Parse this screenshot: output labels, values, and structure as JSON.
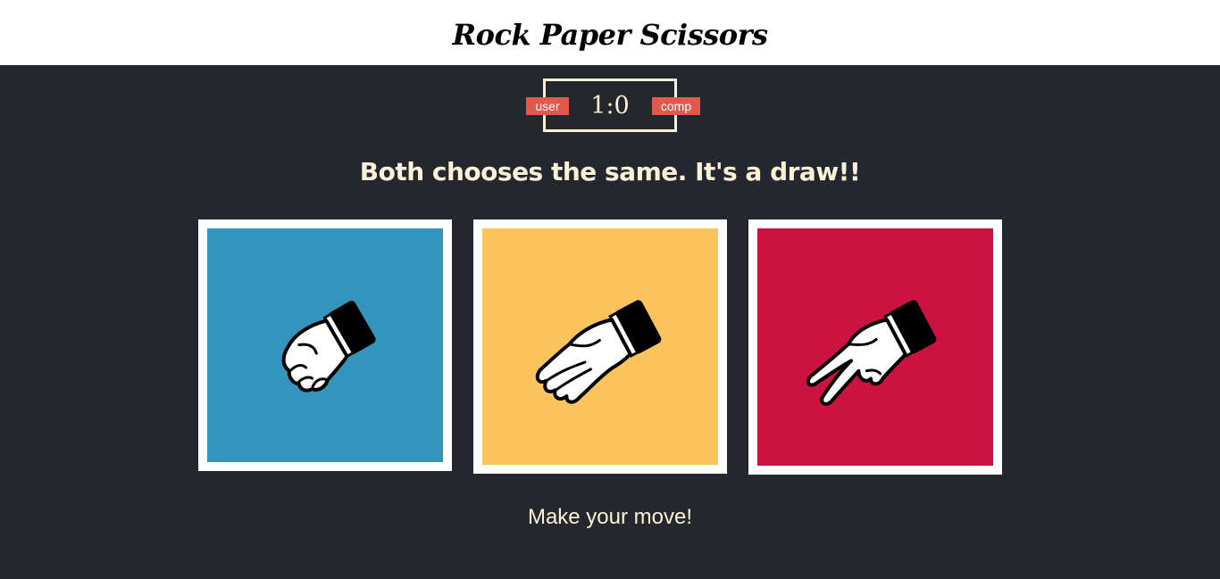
{
  "header": {
    "title": "Rock Paper Scissors"
  },
  "scoreboard": {
    "user_label": "user",
    "comp_label": "comp",
    "score": "1:0",
    "border_color": "#fbf1d9",
    "badge_color": "#e2584d"
  },
  "result": {
    "message": "Both chooses the same. It's a draw!!"
  },
  "choices": [
    {
      "id": "rock",
      "icon": "rock-hand-icon",
      "color": "#3395bb"
    },
    {
      "id": "paper",
      "icon": "paper-hand-icon",
      "color": "#fbc35c"
    },
    {
      "id": "scissors",
      "icon": "scissors-hand-icon",
      "color": "#cc1241"
    }
  ],
  "prompt": {
    "text": "Make your move!"
  },
  "colors": {
    "background": "#24272e",
    "text": "#fbf1d9"
  }
}
